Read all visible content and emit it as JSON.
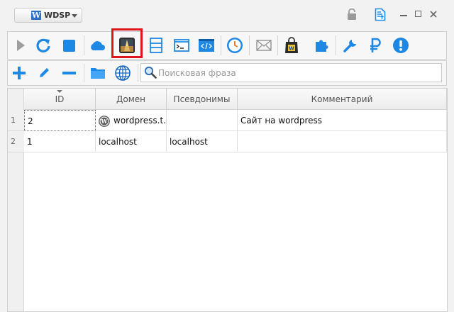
{
  "app": {
    "name": "WDSP",
    "logo_letter": "W"
  },
  "titlebar": {
    "icons": [
      "lock-icon",
      "task-document-icon",
      "minimize-icon",
      "maximize-icon",
      "close-icon"
    ]
  },
  "toolbar": {
    "buttons": [
      "play-icon",
      "refresh-icon",
      "stop-icon",
      "cloud-icon",
      "gallery-icon",
      "list-icon",
      "terminal-icon",
      "code-icon",
      "clock-icon",
      "mail-icon",
      "shop-bag-icon",
      "puzzle-icon",
      "wrench-icon",
      "ruble-icon",
      "alert-icon"
    ],
    "selected": "gallery-icon"
  },
  "edit_toolbar": {
    "buttons": [
      "add-icon",
      "edit-pencil-icon",
      "remove-icon",
      "folder-icon",
      "globe-icon"
    ],
    "search_placeholder": "Поисковая фраза"
  },
  "table": {
    "columns": [
      "ID",
      "Домен",
      "Псевдонимы",
      "Комментарий"
    ],
    "rows": [
      {
        "num": "1",
        "id": "2",
        "domain": "wordpress.t...",
        "aliases": "",
        "comment": "Сайт на wordpress",
        "has_wp_icon": true
      },
      {
        "num": "2",
        "id": "1",
        "domain": "localhost",
        "aliases": "localhost",
        "comment": "",
        "has_wp_icon": false
      }
    ]
  },
  "colors": {
    "accent": "#1e88e5",
    "highlight_border": "#e0141c"
  }
}
